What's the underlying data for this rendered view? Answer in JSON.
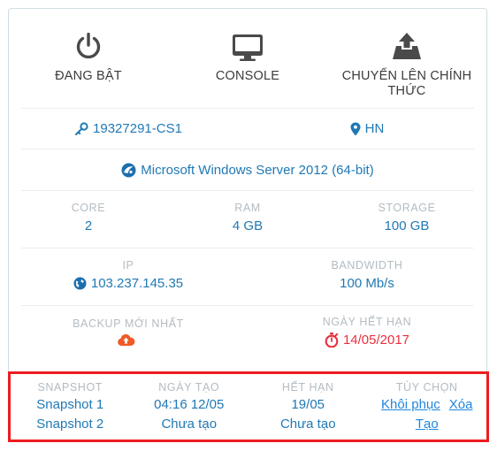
{
  "card": {
    "actions": [
      {
        "icon": "power-icon",
        "label": "ĐANG BẬT"
      },
      {
        "icon": "monitor-icon",
        "label": "CONSOLE"
      },
      {
        "icon": "upload-icon",
        "label": "CHUYỂN LÊN CHÍNH THỨC"
      }
    ],
    "identity": {
      "server_id": "19327291-CS1",
      "server_id_icon": "key-icon",
      "region": "HN",
      "region_icon": "location-pin-icon"
    },
    "os": {
      "icon": "os-globe-icon",
      "name": "Microsoft Windows Server 2012 (64-bit)"
    },
    "specs": [
      {
        "caption": "CORE",
        "value": "2"
      },
      {
        "caption": "RAM",
        "value": "4 GB"
      },
      {
        "caption": "STORAGE",
        "value": "100 GB"
      }
    ],
    "network": {
      "ip": {
        "caption": "IP",
        "value": "103.237.145.35",
        "icon": "globe-icon"
      },
      "bandwidth": {
        "caption": "BANDWIDTH",
        "value": "100 Mb/s"
      }
    },
    "backup": {
      "caption": "BACKUP MỚI NHẤT",
      "icon": "cloud-upload-icon",
      "value": ""
    },
    "expiry": {
      "caption": "NGÀY HẾT HẠN",
      "icon": "stopwatch-icon",
      "value": "14/05/2017"
    },
    "snapshots": {
      "headers": [
        "SNAPSHOT",
        "NGÀY TẠO",
        "HẾT HẠN",
        "TÙY CHỌN"
      ],
      "rows": [
        {
          "name": "Snapshot 1",
          "created": "04:16 12/05",
          "expires": "19/05",
          "options": [
            "Khôi phục",
            "Xóa"
          ]
        },
        {
          "name": "Snapshot 2",
          "created": "Chưa tạo",
          "expires": "Chưa tạo",
          "options": [
            "Tạo"
          ]
        }
      ]
    }
  },
  "colors": {
    "link_blue": "#2079b5",
    "caption_gray": "#b3bcc2",
    "icon_dark": "#4a4a4a",
    "accent_orange": "#f05a28",
    "accent_red": "#e8313d",
    "highlight_border": "#ee1c20",
    "card_border": "#cfdde2"
  }
}
